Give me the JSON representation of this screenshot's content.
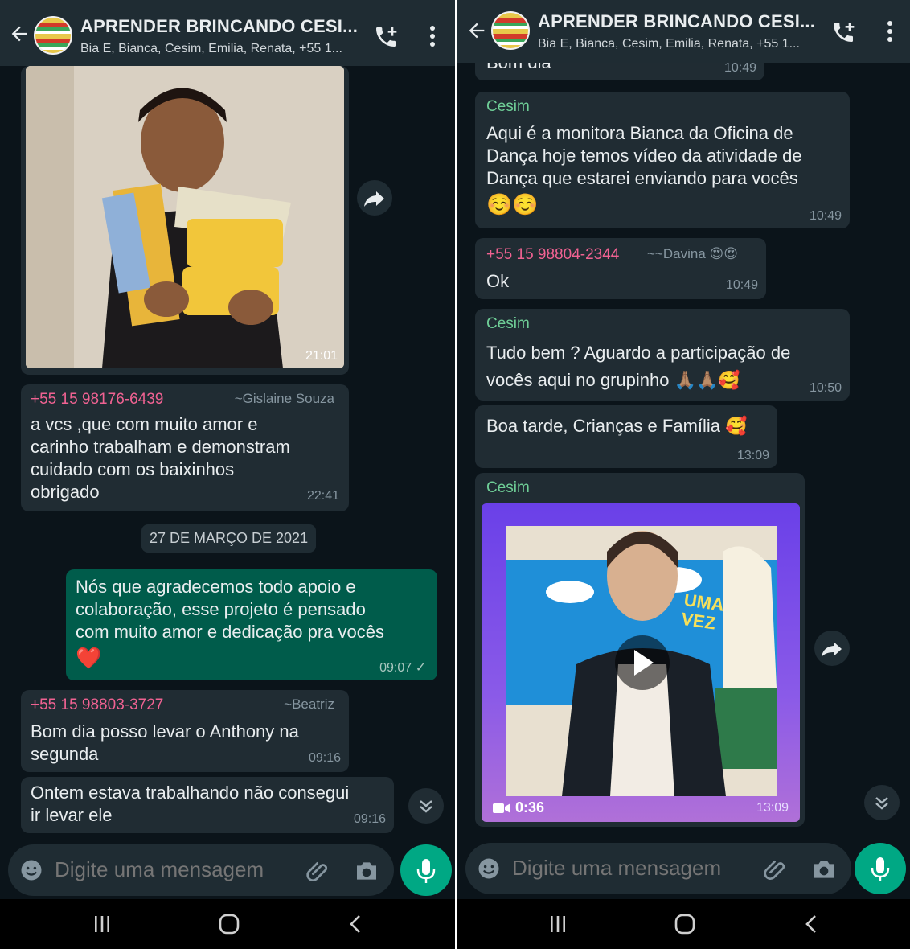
{
  "colors": {
    "chat_bg": "#0b141a",
    "header_bg": "#1f2c33",
    "incoming_bubble": "#202c33",
    "outgoing_bubble": "#005c4b",
    "accent_green": "#00a884",
    "sender_phone": "#f06292",
    "sender_cesim": "#6fcf97"
  },
  "header": {
    "title": "APRENDER BRINCANDO CESI...",
    "subtitle": "Bia E, Bianca, Cesim, Emilia, Renata, +55 1..."
  },
  "input": {
    "placeholder": "Digite uma mensagem"
  },
  "left": {
    "photo_time": "21:01",
    "msg1": {
      "phone": "+55 15 98176-6439",
      "name": "~Gislaine Souza",
      "lines": [
        "a vcs ,que com muito amor e",
        "carinho trabalham e demonstram",
        "cuidado com os baixinhos",
        "obrigado"
      ],
      "time": "22:41"
    },
    "date_chip": "27 DE MARÇO DE 2021",
    "out_msg": {
      "lines": [
        "Nós que agradecemos todo apoio e",
        "colaboração, esse projeto é pensado",
        "com muito amor e dedicação pra vocês"
      ],
      "emoji": "❤️",
      "time": "09:07 ✓"
    },
    "msg2": {
      "phone": "+55 15 98803-3727",
      "name": "~Beatriz",
      "lines": [
        "Bom dia posso levar o Anthony na",
        "segunda"
      ],
      "time": "09:16"
    },
    "msg3": {
      "lines": [
        "Ontem estava trabalhando não consegui",
        "ir levar ele"
      ],
      "time": "09:16"
    }
  },
  "right": {
    "top_partial": {
      "text": "Bom dia",
      "time": "10:49"
    },
    "msg1": {
      "sender": "Cesim",
      "lines": [
        "Aqui é a monitora  Bianca da Oficina de",
        "Dança hoje temos vídeo da atividade de",
        "Dança que estarei enviando para vocês"
      ],
      "emoji": "☺️☺️",
      "time": "10:49"
    },
    "msg2": {
      "phone": "+55 15 98804-2344",
      "name": "~~Davina 😍😍",
      "text": "Ok",
      "time": "10:49"
    },
    "msg3": {
      "sender": "Cesim",
      "lines": [
        "Tudo bem ? Aguardo a participação de",
        "vocês aqui no grupinho 🙏🏽🙏🏽🥰"
      ],
      "time": "10:50"
    },
    "msg4": {
      "text": "Boa tarde, Crianças e Família 🥰",
      "time": "13:09"
    },
    "video": {
      "sender": "Cesim",
      "banner_text": "UMA VEZ",
      "duration": "0:36",
      "time": "13:09"
    }
  }
}
